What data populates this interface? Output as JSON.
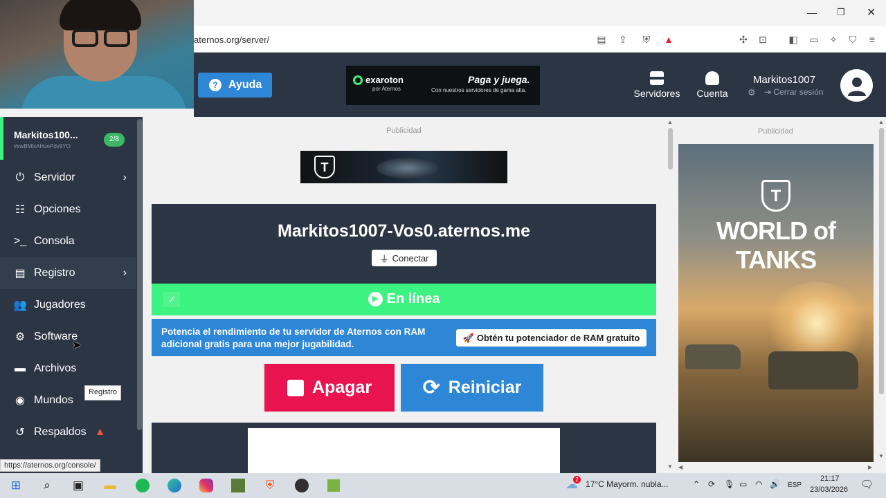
{
  "browser": {
    "url": "aternos.org/server/",
    "status_url": "https://aternos.org/console/"
  },
  "header": {
    "help_label": "Ayuda",
    "help_icon": "question-circle-icon",
    "top_ad": {
      "brand": "exaroton",
      "brand_sub": "por Aternos",
      "headline": "Paga y juega.",
      "sub": "Con nuestros servidores de gama alta."
    },
    "servers_label": "Servidores",
    "account_label": "Cuenta",
    "username": "Markitos1007",
    "logout_label": "Cerrar sesión"
  },
  "sidebar": {
    "server_name": "Markitos100...",
    "server_id": "#swBMlxAHuePdv9YO",
    "player_badge": "2/8",
    "items": [
      {
        "label": "Servidor",
        "icon": "power-icon",
        "chevron": true
      },
      {
        "label": "Opciones",
        "icon": "sliders-icon"
      },
      {
        "label": "Consola",
        "icon": "terminal-icon"
      },
      {
        "label": "Registro",
        "icon": "file-icon",
        "chevron": true
      },
      {
        "label": "Jugadores",
        "icon": "users-icon"
      },
      {
        "label": "Software",
        "icon": "gears-icon"
      },
      {
        "label": "Archivos",
        "icon": "folder-icon"
      },
      {
        "label": "Mundos",
        "icon": "globe-icon"
      },
      {
        "label": "Respaldos",
        "icon": "history-icon",
        "warning": true
      }
    ],
    "tooltip": "Registro"
  },
  "main": {
    "ad_label": "Publicidad",
    "server_address": "Markitos1007-Vos0.aternos.me",
    "connect_label": "Conectar",
    "status_label": "En línea",
    "status_color": "#3cf281",
    "ram_text": "Potencia el rendimiento de tu servidor de Aternos con RAM adicional gratis para una mejor jugabilidad.",
    "ram_button": "Obtén tu potenciador de RAM gratuito",
    "stop_label": "Apagar",
    "restart_label": "Reiniciar"
  },
  "right_ad": {
    "label": "Publicidad",
    "title": "WORLD of TANKS"
  },
  "taskbar": {
    "weather": "17°C  Mayorm. nubla...",
    "lang": "ESP",
    "time": "21:17",
    "date": "23/03/2026",
    "weather_badge": "2"
  }
}
